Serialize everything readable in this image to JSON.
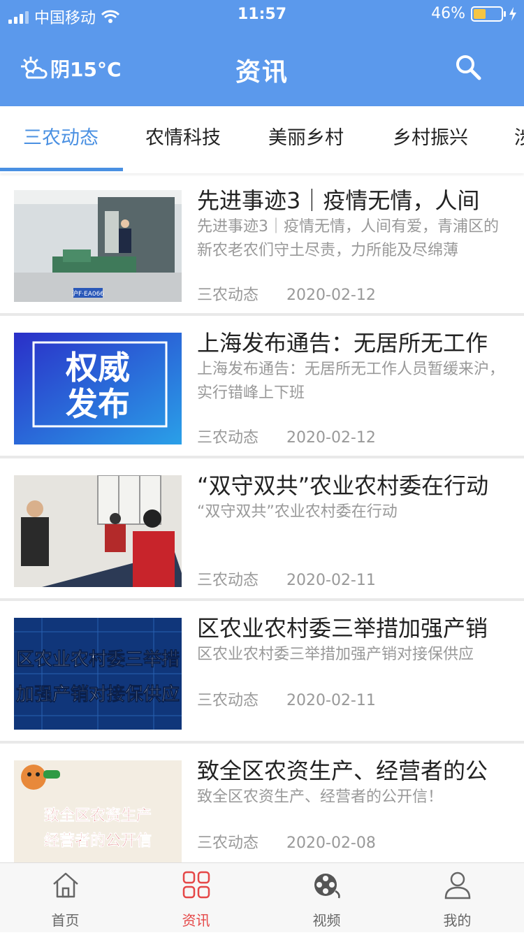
{
  "status_bar": {
    "carrier": "中国移动",
    "time": "11:57",
    "battery": "46%",
    "battery_level": 0.46
  },
  "header": {
    "weather": "阴15°C",
    "title": "资讯"
  },
  "colors": {
    "accent": "#5b99ec",
    "tab_active": "#4a90e2",
    "nav_active": "#e54747",
    "muted": "#999999"
  },
  "tabs": [
    {
      "label": "三农动态",
      "active": true
    },
    {
      "label": "农情科技",
      "active": false
    },
    {
      "label": "美丽乡村",
      "active": false
    },
    {
      "label": "乡村振兴",
      "active": false
    },
    {
      "label": "涉",
      "active": false
    }
  ],
  "articles": [
    {
      "title": "先进事迹3｜疫情无情，人间",
      "desc": "先进事迹3｜疫情无情，人间有爱，青浦区的新农老农们守土尽责，力所能及尽绵薄",
      "category": "三农动态",
      "date": "2020-02-12",
      "plate": "沪F·EA066"
    },
    {
      "title": "上海发布通告：无居所无工作",
      "desc": "上海发布通告：无居所无工作人员暂缓来沪，实行错峰上下班",
      "category": "三农动态",
      "date": "2020-02-12",
      "image_text": [
        "权威",
        "发布"
      ]
    },
    {
      "title": "“双守双共”农业农村委在行动",
      "desc": "“双守双共”农业农村委在行动",
      "category": "三农动态",
      "date": "2020-02-11"
    },
    {
      "title": "区农业农村委三举措加强产销",
      "desc": "区农业农村委三举措加强产销对接保供应",
      "category": "三农动态",
      "date": "2020-02-11",
      "image_text": [
        "区农业农村委三举措",
        "加强产销对接保供应"
      ]
    },
    {
      "title": "致全区农资生产、经营者的公",
      "desc": "致全区农资生产、经营者的公开信！",
      "category": "三农动态",
      "date": "2020-02-08",
      "image_text": [
        "致全区农资生产",
        "经营者的公开信"
      ]
    }
  ],
  "nav": [
    {
      "label": "首页",
      "icon": "home-icon",
      "active": false
    },
    {
      "label": "资讯",
      "icon": "grid-icon",
      "active": true
    },
    {
      "label": "视频",
      "icon": "film-reel-icon",
      "active": false
    },
    {
      "label": "我的",
      "icon": "user-icon",
      "active": false
    }
  ]
}
